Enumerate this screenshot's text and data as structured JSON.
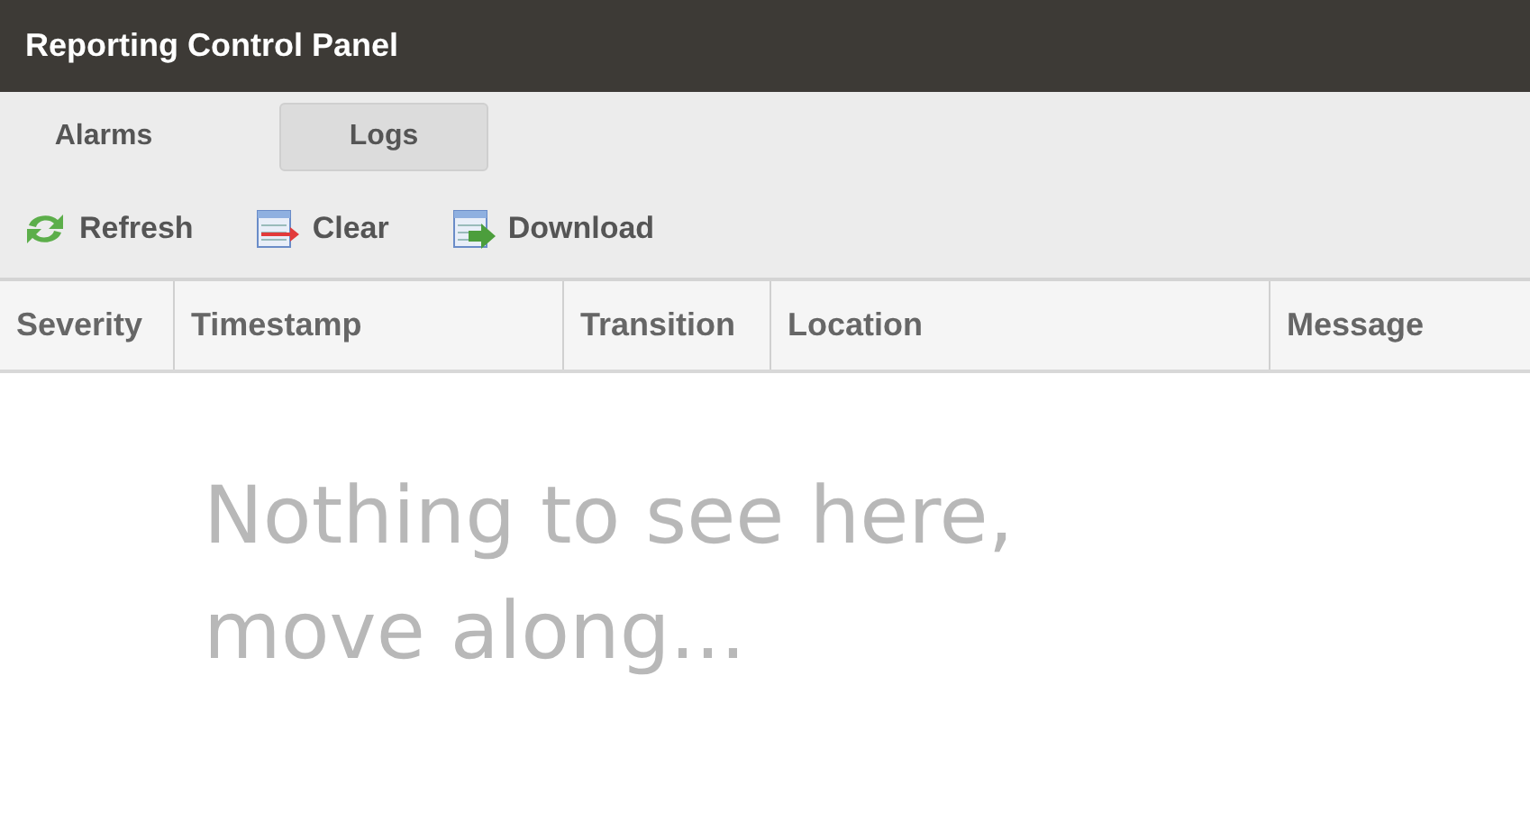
{
  "window": {
    "title": "Reporting Control Panel"
  },
  "tabs": [
    {
      "label": "Alarms",
      "selected": false
    },
    {
      "label": "Logs",
      "selected": true
    }
  ],
  "toolbar": [
    {
      "kind": "refresh",
      "label": "Refresh"
    },
    {
      "kind": "clear",
      "label": "Clear"
    },
    {
      "kind": "download",
      "label": "Download"
    }
  ],
  "table": {
    "columns": [
      "Severity",
      "Timestamp",
      "Transition",
      "Location",
      "Message"
    ],
    "empty_message": "Nothing to see here, move along..."
  }
}
